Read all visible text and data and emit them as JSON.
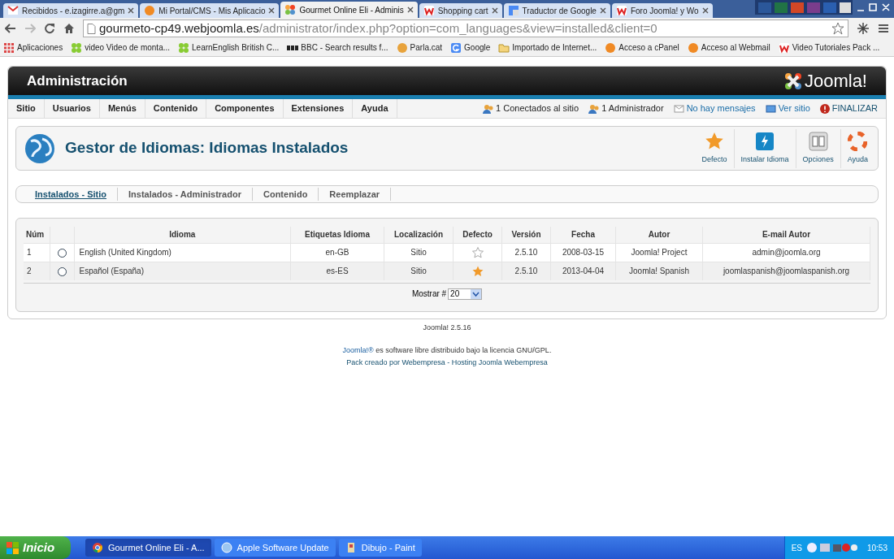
{
  "browser": {
    "tabs": [
      {
        "label": "Recibidos - e.izagirre.a@gm",
        "kind": "mail",
        "selected": false
      },
      {
        "label": "Mi Portal/CMS - Mis Aplicacio",
        "kind": "cp",
        "selected": false
      },
      {
        "label": "Gourmet Online Eli - Adminis",
        "kind": "joomla",
        "selected": true
      },
      {
        "label": "Shopping cart",
        "kind": "w",
        "selected": false
      },
      {
        "label": "Traductor de Google",
        "kind": "translate",
        "selected": false
      },
      {
        "label": "Foro Joomla! y Wo",
        "kind": "w",
        "selected": false
      }
    ],
    "address": {
      "host": "gourmeto-cp49.webjoomla.es",
      "path": "/administrator/index.php?option=com_languages&view=installed&client=0"
    },
    "bookmarks": [
      {
        "label": "Aplicaciones",
        "kind": "apps"
      },
      {
        "label": "video Video de monta...",
        "kind": "dots"
      },
      {
        "label": "LearnEnglish  British C...",
        "kind": "dots"
      },
      {
        "label": "BBC - Search results f...",
        "kind": "bbc"
      },
      {
        "label": "Parla.cat",
        "kind": "face"
      },
      {
        "label": "Google",
        "kind": "google"
      },
      {
        "label": "Importado de Internet...",
        "kind": "folder"
      },
      {
        "label": "Acceso a cPanel",
        "kind": "cp"
      },
      {
        "label": "Acceso al Webmail",
        "kind": "cp"
      },
      {
        "label": "Video Tutoriales Pack ...",
        "kind": "w"
      }
    ]
  },
  "admin": {
    "title": "Administración",
    "logo": "Joomla!",
    "menu": [
      "Sitio",
      "Usuarios",
      "Menús",
      "Contenido",
      "Componentes",
      "Extensiones",
      "Ayuda"
    ],
    "status": [
      {
        "label": "1 Conectados al sitio",
        "kind": "users"
      },
      {
        "label": "1 Administrador",
        "kind": "users"
      },
      {
        "label": "No hay mensajes",
        "kind": "mail"
      },
      {
        "label": "Ver sitio",
        "kind": "site"
      },
      {
        "label": "FINALIZAR",
        "kind": "logout"
      }
    ],
    "page_title": "Gestor de Idiomas: Idiomas Instalados",
    "toolbar": [
      {
        "label": "Defecto",
        "kind": "star"
      },
      {
        "label": "Instalar Idioma",
        "kind": "install"
      },
      {
        "label": "Opciones",
        "kind": "options"
      },
      {
        "label": "Ayuda",
        "kind": "help"
      }
    ],
    "subtabs": [
      {
        "label": "Instalados - Sitio",
        "selected": true
      },
      {
        "label": "Instalados - Administrador",
        "selected": false
      },
      {
        "label": "Contenido",
        "selected": false
      },
      {
        "label": "Reemplazar",
        "selected": false
      }
    ],
    "table": {
      "columns": [
        "Núm",
        "Idioma",
        "Etiquetas Idioma",
        "Localización",
        "Defecto",
        "Versión",
        "Fecha",
        "Autor",
        "E-mail Autor"
      ],
      "rows": [
        {
          "num": "1",
          "checked": false,
          "idioma": "English (United Kingdom)",
          "etiqueta": "en-GB",
          "localizacion": "Sitio",
          "default": false,
          "version": "2.5.10",
          "fecha": "2008-03-15",
          "autor": "Joomla! Project",
          "email": "admin@joomla.org"
        },
        {
          "num": "2",
          "checked": false,
          "idioma": "Español (España)",
          "etiqueta": "es-ES",
          "localizacion": "Sitio",
          "default": true,
          "version": "2.5.10",
          "fecha": "2013-04-04",
          "autor": "Joomla! Spanish",
          "email": "joomlaspanish@joomlaspanish.org"
        }
      ]
    },
    "pagination": {
      "label": "Mostrar #",
      "value": "20"
    },
    "footer": {
      "version": "Joomla! 2.5.16",
      "license_link": "Joomla!®",
      "license_text": "es software libre distribuido bajo la licencia GNU/GPL.",
      "credits": "Pack creado por Webempresa - Hosting Joomla Webempresa"
    }
  },
  "taskbar": {
    "start": "Inicio",
    "tasks": [
      {
        "label": "Gourmet Online Eli - A...",
        "kind": "chrome",
        "selected": true
      },
      {
        "label": "Apple Software Update",
        "kind": "globe",
        "selected": false
      },
      {
        "label": "Dibujo - Paint",
        "kind": "paint",
        "selected": false
      }
    ],
    "lang": "ES",
    "clock": "10:53"
  }
}
